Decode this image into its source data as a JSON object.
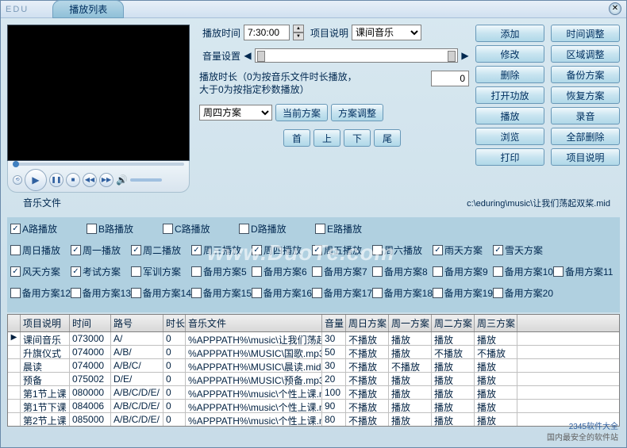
{
  "app_name": "EDU",
  "title": "播放列表",
  "form": {
    "play_time_label": "播放时间",
    "play_time_value": "7:30:00",
    "item_desc_label": "项目说明",
    "item_desc_value": "课间音乐",
    "volume_label": "音量设置",
    "duration_note1": "播放时长（0为按音乐文件时长播放，",
    "duration_note2": "大于0为按指定秒数播放）",
    "duration_value": "0",
    "scheme_value": "周四方案",
    "current_scheme_btn": "当前方案",
    "scheme_adjust_btn": "方案调整",
    "nav_first": "首",
    "nav_prev": "上",
    "nav_next": "下",
    "nav_last": "尾",
    "music_file_label": "音乐文件",
    "music_file_path": "c:\\eduring\\music\\让我们荡起双桨.mid"
  },
  "buttons_col1": [
    "添加",
    "修改",
    "删除",
    "打开功放",
    "播放",
    "浏览",
    "打印"
  ],
  "buttons_col2": [
    "时间调整",
    "区域调整",
    "备份方案",
    "恢复方案",
    "录音",
    "全部删除",
    "项目说明"
  ],
  "checkboxes": {
    "row1": [
      {
        "label": "A路播放",
        "checked": true
      },
      {
        "label": "B路播放",
        "checked": false
      },
      {
        "label": "C路播放",
        "checked": false
      },
      {
        "label": "D路播放",
        "checked": false
      },
      {
        "label": "E路播放",
        "checked": false
      }
    ],
    "row2": [
      {
        "label": "周日播放",
        "checked": false
      },
      {
        "label": "周一播放",
        "checked": true
      },
      {
        "label": "周二播放",
        "checked": true
      },
      {
        "label": "周三播放",
        "checked": true
      },
      {
        "label": "周四播放",
        "checked": true
      },
      {
        "label": "周五播放",
        "checked": true
      },
      {
        "label": "周六播放",
        "checked": false
      },
      {
        "label": "雨天方案",
        "checked": true
      },
      {
        "label": "雪天方案",
        "checked": true
      }
    ],
    "row3": [
      {
        "label": "风天方案",
        "checked": true
      },
      {
        "label": "考试方案",
        "checked": true
      },
      {
        "label": "军训方案",
        "checked": false
      },
      {
        "label": "备用方案5",
        "checked": false
      },
      {
        "label": "备用方案6",
        "checked": false
      },
      {
        "label": "备用方案7",
        "checked": false
      },
      {
        "label": "备用方案8",
        "checked": false
      },
      {
        "label": "备用方案9",
        "checked": false
      },
      {
        "label": "备用方案10",
        "checked": false
      },
      {
        "label": "备用方案11",
        "checked": false
      }
    ],
    "row4": [
      {
        "label": "备用方案12",
        "checked": false
      },
      {
        "label": "备用方案13",
        "checked": false
      },
      {
        "label": "备用方案14",
        "checked": false
      },
      {
        "label": "备用方案15",
        "checked": false
      },
      {
        "label": "备用方案16",
        "checked": false
      },
      {
        "label": "备用方案17",
        "checked": false
      },
      {
        "label": "备用方案18",
        "checked": false
      },
      {
        "label": "备用方案19",
        "checked": false
      },
      {
        "label": "备用方案20",
        "checked": false
      }
    ]
  },
  "grid": {
    "headers": [
      "",
      "项目说明",
      "时间",
      "路号",
      "时长",
      "音乐文件",
      "音量",
      "周日方案",
      "周一方案",
      "周二方案",
      "周三方案"
    ],
    "rows": [
      {
        "marker": "▶",
        "cells": [
          "课间音乐",
          "073000",
          "A/",
          "0",
          "%APPPATH%\\music\\让我们荡起XX",
          "30",
          "不播放",
          "播放",
          "播放",
          "播放"
        ]
      },
      {
        "marker": "",
        "cells": [
          "升旗仪式",
          "074000",
          "A/B/",
          "0",
          "%APPPATH%\\MUSIC\\国歌.mp3",
          "50",
          "不播放",
          "播放",
          "不播放",
          "不播放"
        ]
      },
      {
        "marker": "",
        "cells": [
          "晨读",
          "074000",
          "A/B/C/",
          "0",
          "%APPPATH%\\MUSIC\\晨读.mid",
          "30",
          "不播放",
          "不播放",
          "播放",
          "播放"
        ]
      },
      {
        "marker": "",
        "cells": [
          "预备",
          "075002",
          "D/E/",
          "0",
          "%APPPATH%\\MUSIC\\预备.mp3",
          "20",
          "不播放",
          "播放",
          "播放",
          "播放"
        ]
      },
      {
        "marker": "",
        "cells": [
          "第1节上课",
          "080000",
          "A/B/C/D/E/",
          "0",
          "%APPPATH%\\music\\个性上课.mp3",
          "100",
          "不播放",
          "播放",
          "播放",
          "播放"
        ]
      },
      {
        "marker": "",
        "cells": [
          "第1节下课",
          "084006",
          "A/B/C/D/E/",
          "0",
          "%APPPATH%\\music\\个性上课.mp3",
          "90",
          "不播放",
          "播放",
          "播放",
          "播放"
        ]
      },
      {
        "marker": "",
        "cells": [
          "第2节上课",
          "085000",
          "A/B/C/D/E/",
          "0",
          "%APPPATH%\\music\\个性上课.mp3",
          "80",
          "不播放",
          "播放",
          "播放",
          "播放"
        ]
      }
    ]
  },
  "watermark": "www.DuoTe.com",
  "badge": "2345软件大全",
  "badge2": "国内最安全的软件站"
}
